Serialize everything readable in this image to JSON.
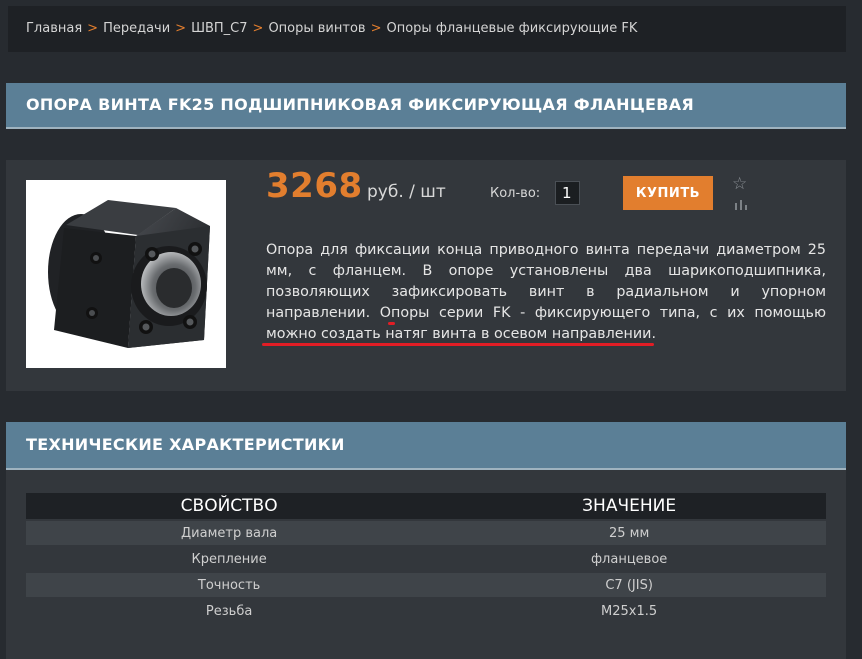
{
  "breadcrumb": {
    "items": [
      "Главная",
      "Передачи",
      "ШВП_С7",
      "Опоры винтов",
      "Опоры фланцевые фиксирующие FK"
    ],
    "separator": ">"
  },
  "product": {
    "title": "ОПОРА ВИНТА FK25 ПОДШИПНИКОВАЯ ФИКСИРУЮЩАЯ ФЛАНЦЕВАЯ",
    "price": "3268",
    "unit": "руб. / шт",
    "quantity_label": "Кол-во:",
    "quantity_value": "1",
    "buy_label": "КУПИТЬ",
    "favorite_icon": "star-icon",
    "compare_icon": "bar-chart-icon",
    "description": {
      "p1": "Опора для фиксации конца приводного винта передачи диаметром 25 мм, с фланцем. В опоре установлены два шарикоподшипника, позволяющих ",
      "h1": "зафиксировать винт в радиальном и упорном направлении",
      "p2": ". Опоры серии FK - фиксирующего типа, с их помощью ",
      "h2": "можно создать натяг винта в осевом направлении",
      "p3": "."
    }
  },
  "specs": {
    "title": "ТЕХНИЧЕСКИЕ ХАРАКТЕРИСТИКИ",
    "columns": [
      "СВОЙСТВО",
      "ЗНАЧЕНИЕ"
    ],
    "rows": [
      [
        "Диаметр вала",
        "25 мм"
      ],
      [
        "Крепление",
        "фланцевое"
      ],
      [
        "Точность",
        "С7 (JIS)"
      ],
      [
        "Резьба",
        "M25x1.5"
      ]
    ]
  },
  "colors": {
    "accent": "#e27e2e",
    "header_bar": "#5b7f96",
    "background": "#272b30",
    "panel": "#33373c",
    "highlight_underline": "#e21d25"
  }
}
